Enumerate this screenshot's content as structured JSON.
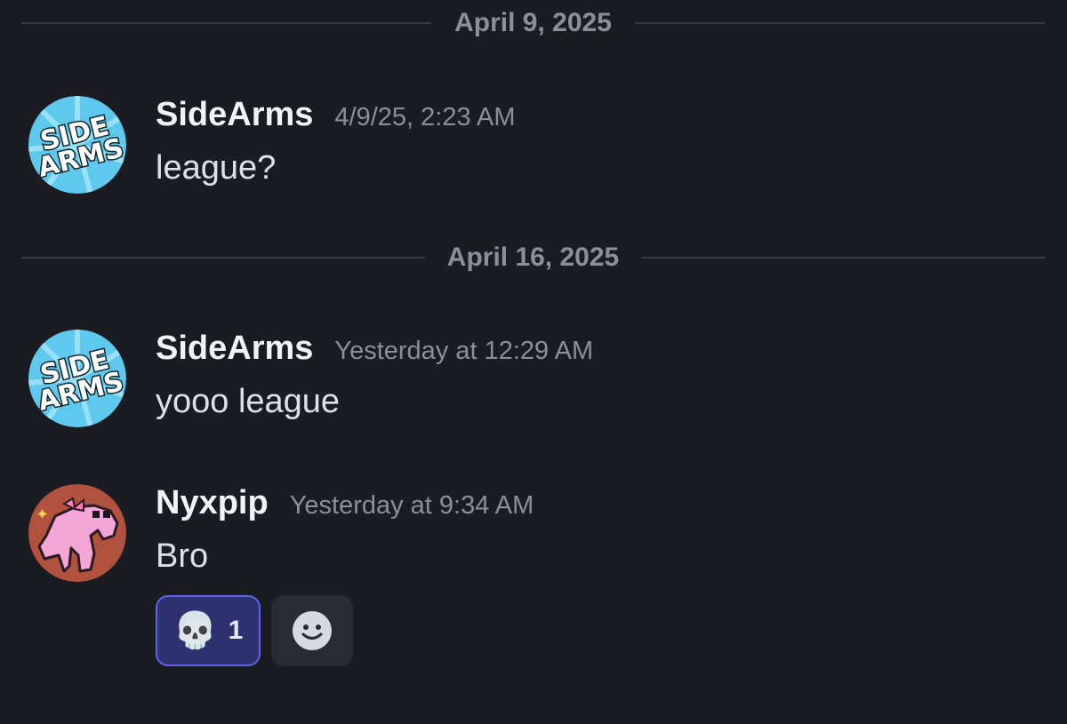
{
  "dividers": [
    {
      "date": "April 9, 2025"
    },
    {
      "date": "April 16, 2025"
    }
  ],
  "messages": [
    {
      "author": "SideArms",
      "timestamp": "4/9/25, 2:23 AM",
      "text": "league?",
      "avatar_logo": [
        "SIDE",
        "ARMS"
      ]
    },
    {
      "author": "SideArms",
      "timestamp": "Yesterday at 12:29 AM",
      "text": "yooo league",
      "avatar_logo": [
        "SIDE",
        "ARMS"
      ]
    },
    {
      "author": "Nyxpip",
      "timestamp": "Yesterday at 9:34 AM",
      "text": "Bro",
      "reactions": [
        {
          "emoji": "💀",
          "count": "1",
          "icon": "skull-emoji",
          "active": true
        }
      ],
      "add_reaction_icon": "smiley-add-reaction-icon"
    }
  ],
  "colors": {
    "background": "#1b1c21",
    "divider_line": "#3a3b42",
    "muted_text": "#8d8f98",
    "reaction_active_bg": "#2e3170",
    "reaction_active_border": "#5b64ea",
    "sidearms_avatar_bg": "#5ec9ec",
    "nyxpip_avatar_bg": "#b0523e",
    "nyxpip_pink": "#f4a6d7"
  }
}
